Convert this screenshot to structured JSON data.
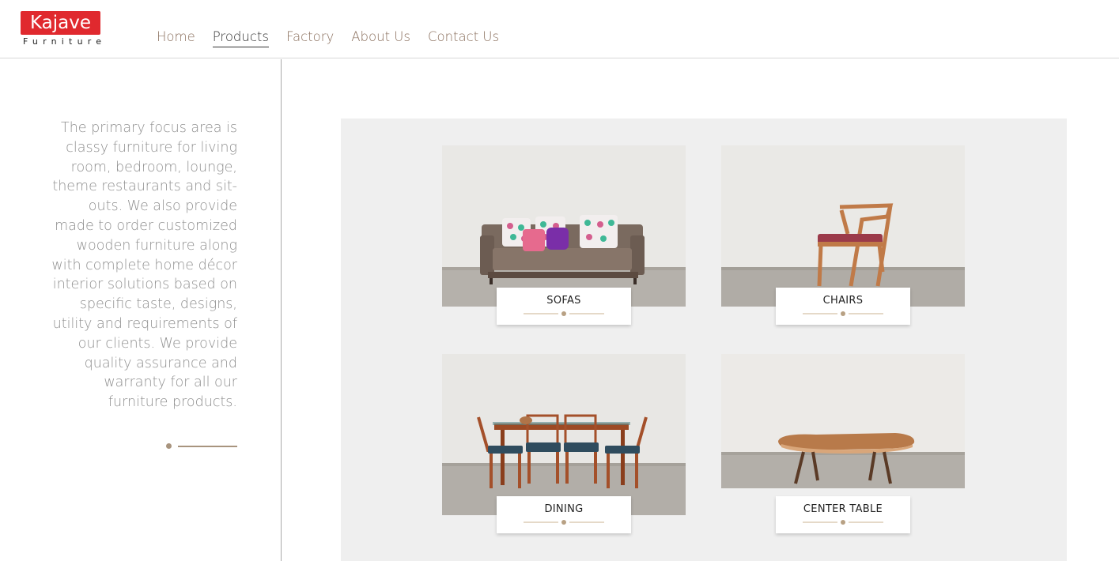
{
  "brand": {
    "name": "Kajave",
    "sub": "Furniture",
    "color": "#e0292e"
  },
  "nav": {
    "items": [
      {
        "label": "Home",
        "active": false
      },
      {
        "label": "Products",
        "active": true
      },
      {
        "label": "Factory",
        "active": false
      },
      {
        "label": "About Us",
        "active": false
      },
      {
        "label": "Contact Us",
        "active": false
      }
    ]
  },
  "intro": {
    "text": "The primary focus area is classy furniture for living room, bedroom, lounge, theme restaurants and sit-outs. We also provide made to order customized wooden furniture along with complete home décor interior solutions based on specific taste, designs, utility and requirements of our clients. We provide quality assurance and warranty for all our furniture products."
  },
  "products": {
    "items": [
      {
        "label": "SOFAS",
        "icon": "sofa-image"
      },
      {
        "label": "CHAIRS",
        "icon": "chair-image"
      },
      {
        "label": "DINING",
        "icon": "dining-set-image"
      },
      {
        "label": "CENTER TABLE",
        "icon": "center-table-image"
      }
    ]
  },
  "colors": {
    "accent": "#a8947e",
    "nav_text": "#8a6f5d",
    "panel_bg": "#efefef"
  }
}
